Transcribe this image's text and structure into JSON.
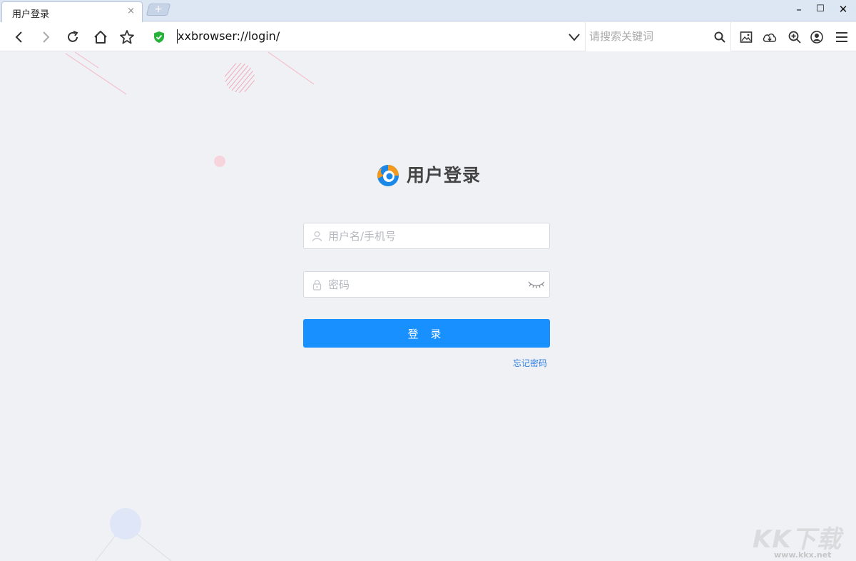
{
  "tab": {
    "title": "用户登录",
    "close": "×"
  },
  "newtab": {
    "label": "+"
  },
  "window": {
    "minimize": "–",
    "maximize": "☐",
    "close": "✕"
  },
  "address": {
    "url": "xxbrowser://login/"
  },
  "search": {
    "placeholder": "请搜索关键词"
  },
  "login": {
    "title": "用户登录",
    "username_placeholder": "用户名/手机号",
    "password_placeholder": "密码",
    "submit_label": "登 录",
    "forgot_label": "忘记密码"
  },
  "watermark": {
    "big": "KK下载",
    "small": "www.kkx.net"
  },
  "colors": {
    "primary": "#1890ff",
    "link": "#2e7ee0",
    "background": "#f0f1f5",
    "secure": "#27b33b"
  }
}
